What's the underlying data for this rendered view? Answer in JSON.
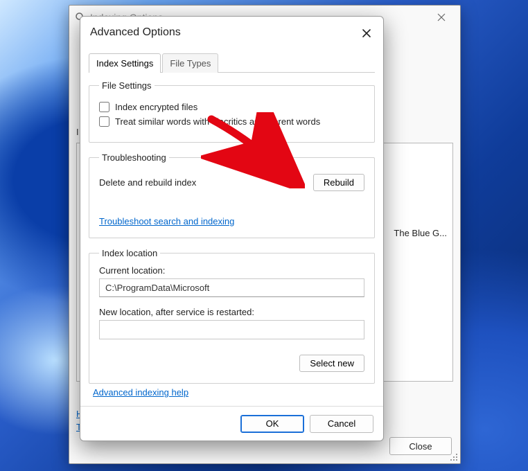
{
  "colors": {
    "accent": "#1a6fd8",
    "link": "#0066cc",
    "arrow": "#e30613"
  },
  "bgwin": {
    "title": "Indexing Options",
    "partial_letter": "I",
    "list_visible_text": "The Blue G...",
    "link_h": "H",
    "link_t": "T",
    "close_label": "Close"
  },
  "modal": {
    "title": "Advanced Options",
    "tabs": [
      {
        "label": "Index Settings",
        "active": true
      },
      {
        "label": "File Types",
        "active": false
      }
    ],
    "file_settings": {
      "legend": "File Settings",
      "cbx_encrypted": {
        "label": "Index encrypted files",
        "checked": false
      },
      "cbx_diacritics": {
        "label": "Treat similar words with diacritics as different words",
        "checked": false
      }
    },
    "troubleshooting": {
      "legend": "Troubleshooting",
      "delete_label": "Delete and rebuild index",
      "rebuild_label": "Rebuild",
      "tshoot_link": "Troubleshoot search and indexing"
    },
    "index_location": {
      "legend": "Index location",
      "current_label": "Current location:",
      "current_value": "C:\\ProgramData\\Microsoft",
      "new_label": "New location, after service is restarted:",
      "new_value": "",
      "select_new_label": "Select new"
    },
    "help_link": "Advanced indexing help",
    "ok_label": "OK",
    "cancel_label": "Cancel"
  }
}
